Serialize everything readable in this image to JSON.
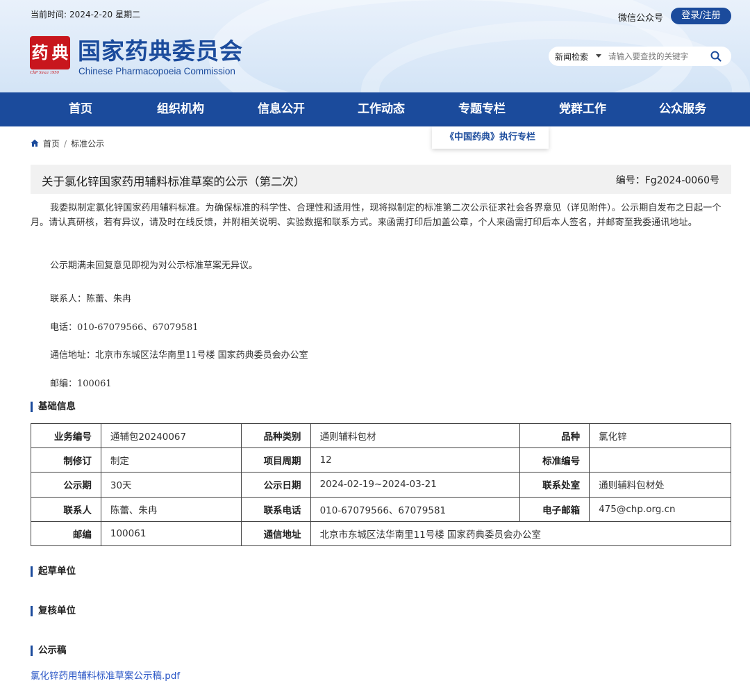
{
  "header": {
    "datetime_label": "当前时间:",
    "date": "2024-2-20",
    "weekday": "星期二",
    "wechat": "微信公众号",
    "login": "登录/注册",
    "org_name_cn": "国家药典委员会",
    "org_name_en": "Chinese Pharmacopoeia Commission",
    "logo_since": "ChP Since 1950",
    "logo_chars": [
      "药",
      "典"
    ],
    "search_scope": "新闻检索",
    "search_placeholder": "请输入要查找的关键字"
  },
  "nav": {
    "items": [
      "首页",
      "组织机构",
      "信息公开",
      "工作动态",
      "专题专栏",
      "党群工作",
      "公众服务"
    ],
    "dropdown_item": "《中国药典》执行专栏"
  },
  "breadcrumb": {
    "home": "首页",
    "current": "标准公示"
  },
  "article": {
    "title": "关于氯化锌国家药用辅料标准草案的公示（第二次）",
    "code": "编号：Fg2024-0060号",
    "paragraph1": "我委拟制定氯化锌国家药用辅料标准。为确保标准的科学性、合理性和适用性，现将拟制定的标准第二次公示征求社会各界意见（详见附件）。公示期自发布之日起一个月。请认真研核，若有异议，请及时在线反馈，并附相关说明、实验数据和联系方式。来函需打印后加盖公章，个人来函需打印后本人签名，并邮寄至我委通讯地址。",
    "note": "公示期满未回复意见即视为对公示标准草案无异议。",
    "contact": "联系人：陈蕾、朱冉",
    "phone": "电话：010-67079566、67079581",
    "address": "通信地址：北京市东城区法华南里11号楼 国家药典委员会办公室",
    "postcode": "邮编：100061"
  },
  "sections": {
    "basic": "基础信息",
    "drafter": "起草单位",
    "reviewer": "复核单位",
    "draft": "公示稿"
  },
  "info_table": {
    "rows": [
      [
        "业务编号",
        "通辅包20240067",
        "品种类别",
        "通则辅料包材",
        "品种",
        "氯化锌"
      ],
      [
        "制修订",
        "制定",
        "项目周期",
        "12",
        "标准编号",
        ""
      ],
      [
        "公示期",
        "30天",
        "公示日期",
        "2024-02-19~2024-03-21",
        "联系处室",
        "通则辅料包材处"
      ],
      [
        "联系人",
        "陈蕾、朱冉",
        "联系电话",
        "010-67079566、67079581",
        "电子邮箱",
        "475@chp.org.cn"
      ]
    ],
    "last_row": [
      "邮编",
      "100061",
      "通信地址",
      "北京市东城区法华南里11号楼 国家药典委员会办公室"
    ]
  },
  "attachment": "氯化锌药用辅料标准草案公示稿.pdf",
  "colors": {
    "brand_blue": "#1b4b9c",
    "seal_red": "#c8161d",
    "link_blue": "#2a56c6"
  }
}
